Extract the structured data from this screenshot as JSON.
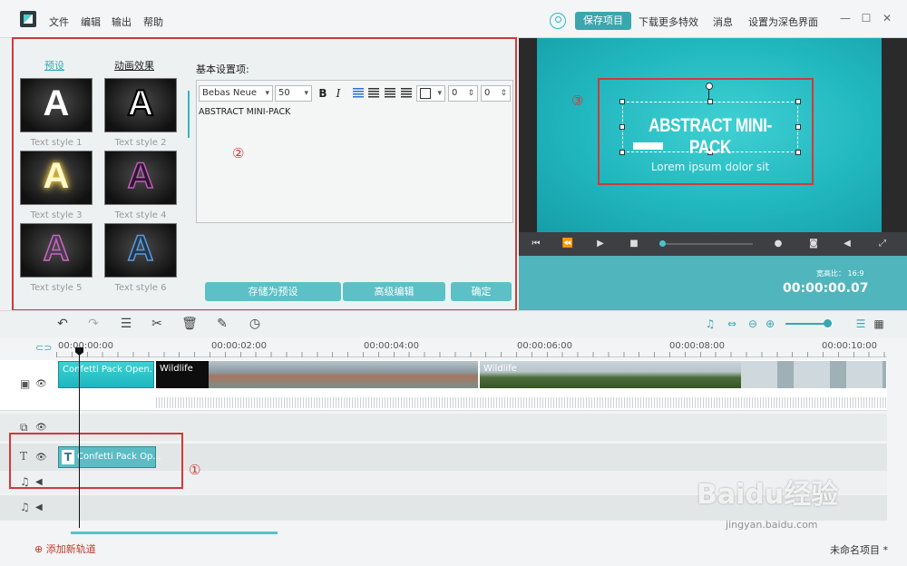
{
  "menu": [
    "文件",
    "编辑",
    "输出",
    "帮助"
  ],
  "header": {
    "save_project": "保存项目",
    "download_effects": "下载更多特效",
    "messages": "消息",
    "dark_theme": "设置为深色界面"
  },
  "window_controls": {
    "min": "—",
    "max": "☐",
    "close": "✕"
  },
  "left_panel": {
    "tab_presets": "预设",
    "tab_animation": "动画效果",
    "styles": [
      {
        "glyph": "A",
        "caption": "Text style 1"
      },
      {
        "glyph": "A",
        "caption": "Text style 2"
      },
      {
        "glyph": "A",
        "caption": "Text style 3"
      },
      {
        "glyph": "A",
        "caption": "Text style 4"
      },
      {
        "glyph": "A",
        "caption": "Text style 5"
      },
      {
        "glyph": "A",
        "caption": "Text style 6"
      }
    ],
    "settings_label": "基本设置项:",
    "font": "Bebas Neue",
    "size": "50",
    "bold": "B",
    "italic": "I",
    "spin_1": "0",
    "spin_2": "0",
    "text_content": "ABSTRACT MINI-PACK",
    "save_preset": "存储为预设",
    "advanced_edit": "高级编辑",
    "confirm": "确定"
  },
  "markers": {
    "m1": "①",
    "m2": "②",
    "m3": "③"
  },
  "preview": {
    "title": "ABSTRACT MINI-PACK",
    "subtitle": "Lorem ipsum dolor sit",
    "aspect_ratio": "宽高比： 16:9",
    "timecode": "00:00:00.07"
  },
  "ruler": [
    "00:00:00:00",
    "00:00:02:00",
    "00:00:04:00",
    "00:00:06:00",
    "00:00:08:00",
    "00:00:10:00"
  ],
  "timeline": {
    "clip_confetti": "Confetti Pack Open...",
    "clip_wildlife_1": "Wildlife",
    "clip_wildlife_2": "Wildlife",
    "text_clip": "Confetti Pack Op..."
  },
  "footer": {
    "add_track": "添加新轨道",
    "project_name": "未命名项目 *"
  },
  "watermark": {
    "brand": "Baidu经验",
    "url": "jingyan.baidu.com"
  },
  "colors": {
    "accent": "#3aa6ae",
    "highlight": "#d03a3a"
  }
}
